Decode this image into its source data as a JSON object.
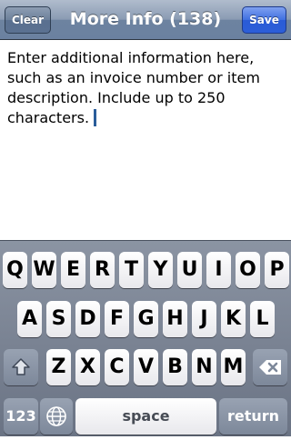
{
  "nav": {
    "title": "More Info (138)",
    "clear_label": "Clear",
    "save_label": "Save"
  },
  "text_area": {
    "value": "Enter additional information here, such as an invoice number or item description. Include up to 250 characters."
  },
  "keyboard": {
    "row1": [
      "Q",
      "W",
      "E",
      "R",
      "T",
      "Y",
      "U",
      "I",
      "O",
      "P"
    ],
    "row2": [
      "A",
      "S",
      "D",
      "F",
      "G",
      "H",
      "J",
      "K",
      "L"
    ],
    "row3": [
      "Z",
      "X",
      "C",
      "V",
      "B",
      "N",
      "M"
    ],
    "numbers_label": "123",
    "space_label": "space",
    "return_label": "return",
    "shift_icon": "shift-arrow-icon",
    "globe_icon": "globe-icon",
    "backspace_icon": "backspace-icon"
  }
}
